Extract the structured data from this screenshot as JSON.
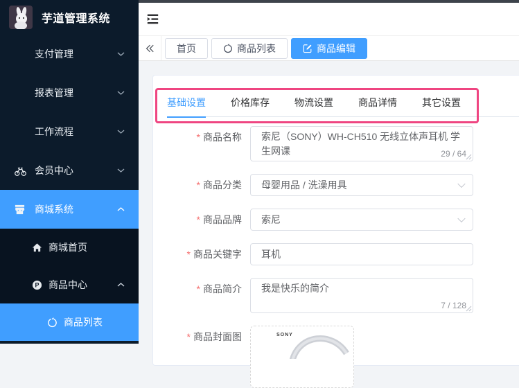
{
  "app": {
    "title": "芋道管理系统"
  },
  "sidebar": {
    "items": [
      {
        "label": "支付管理",
        "icon": "none",
        "state": "collapsed"
      },
      {
        "label": "报表管理",
        "icon": "none",
        "state": "collapsed"
      },
      {
        "label": "工作流程",
        "icon": "none",
        "state": "collapsed"
      },
      {
        "label": "会员中心",
        "icon": "bicycle",
        "state": "collapsed"
      },
      {
        "label": "商城系统",
        "icon": "store",
        "state": "expanded",
        "active": true
      },
      {
        "label": "商城首页",
        "icon": "home"
      },
      {
        "label": "商品中心",
        "icon": "p-badge",
        "state": "expanded"
      },
      {
        "label": "商品列表",
        "icon": "ring",
        "active": true
      }
    ]
  },
  "tags": {
    "items": [
      {
        "label": "首页"
      },
      {
        "label": "商品列表",
        "icon": "ring"
      },
      {
        "label": "商品编辑",
        "icon": "edit",
        "active": true
      }
    ]
  },
  "tabs": {
    "items": [
      "基础设置",
      "价格库存",
      "物流设置",
      "商品详情",
      "其它设置"
    ],
    "active_index": 0
  },
  "form": {
    "required_mark": "*",
    "fields": {
      "name": {
        "label": "商品名称",
        "required": true,
        "value": "索尼（SONY）WH-CH510 无线立体声耳机 学生网课",
        "counter": "29 / 64"
      },
      "category": {
        "label": "商品分类",
        "required": true,
        "value": "母婴用品 / 洗澡用具"
      },
      "brand": {
        "label": "商品品牌",
        "required": true,
        "value": "索尼"
      },
      "keyword": {
        "label": "商品关键字",
        "required": true,
        "value": "耳机"
      },
      "intro": {
        "label": "商品简介",
        "required": true,
        "value": "我是快乐的简介",
        "counter": "7 / 128"
      },
      "cover": {
        "label": "商品封面图",
        "required": true,
        "image_brand": "SONY"
      }
    }
  },
  "colors": {
    "primary": "#409EFF",
    "annotation_pink": "#EF4581",
    "sidebar_bg": "#0C1B2B",
    "submenu_bg": "#081320",
    "danger_red": "#F56C6C"
  }
}
